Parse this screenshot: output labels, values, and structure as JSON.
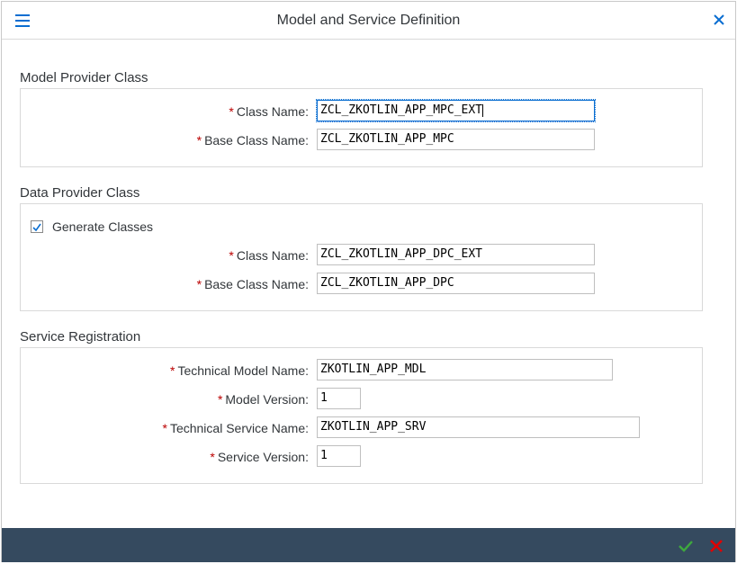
{
  "dialog": {
    "title": "Model and Service Definition"
  },
  "model_provider": {
    "title": "Model Provider Class",
    "class_name_label": "Class Name:",
    "class_name_value": "ZCL_ZKOTLIN_APP_MPC_EXT",
    "base_class_label": "Base Class Name:",
    "base_class_value": "ZCL_ZKOTLIN_APP_MPC"
  },
  "data_provider": {
    "title": "Data Provider Class",
    "generate_label": "Generate Classes",
    "generate_checked": true,
    "class_name_label": "Class Name:",
    "class_name_value": "ZCL_ZKOTLIN_APP_DPC_EXT",
    "base_class_label": "Base Class Name:",
    "base_class_value": "ZCL_ZKOTLIN_APP_DPC"
  },
  "service_registration": {
    "title": "Service Registration",
    "tech_model_label": "Technical Model Name:",
    "tech_model_value": "ZKOTLIN_APP_MDL",
    "model_version_label": "Model Version:",
    "model_version_value": "1",
    "tech_service_label": "Technical Service Name:",
    "tech_service_value": "ZKOTLIN_APP_SRV",
    "service_version_label": "Service Version:",
    "service_version_value": "1"
  },
  "required_marker": "*",
  "colors": {
    "accent": "#0a6ed1",
    "required": "#bb0000",
    "footer": "#354a5f",
    "confirm": "#2b7d2b",
    "cancel": "#e00000"
  }
}
